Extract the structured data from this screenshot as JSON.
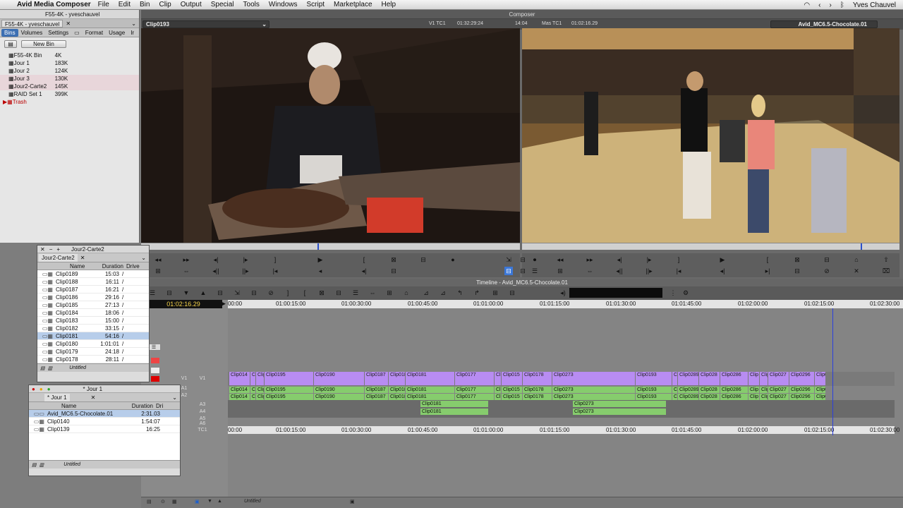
{
  "menubar": {
    "app": "Avid Media Composer",
    "items": [
      "File",
      "Edit",
      "Bin",
      "Clip",
      "Output",
      "Special",
      "Tools",
      "Windows",
      "Script",
      "Marketplace",
      "Help"
    ],
    "user": "Yves Chauvel"
  },
  "project": {
    "title": "F55-4K - yveschauvel",
    "tab": "F55-4K - yveschauvel",
    "tabs": [
      "Bins",
      "Volumes",
      "Settings",
      "Format",
      "Usage",
      "Ir"
    ],
    "new_bin": "New Bin",
    "bins": [
      {
        "name": "F55-4K Bin",
        "size": "4K"
      },
      {
        "name": "Jour 1",
        "size": "183K"
      },
      {
        "name": "Jour 2",
        "size": "124K"
      },
      {
        "name": "Jour 3",
        "size": "130K"
      },
      {
        "name": "Jour2-Carte2",
        "size": "145K"
      },
      {
        "name": "RAID Set 1",
        "size": "399K"
      },
      {
        "name": "Trash",
        "size": ""
      }
    ]
  },
  "composer": {
    "title": "Composer",
    "source_clip": "Clip0193",
    "v1_tc_label": "V1 TC1",
    "v1_tc": "01:32:29:24",
    "dur": "14:04",
    "mas_label": "Mas TC1",
    "mas_tc": "01:02:16.29",
    "record_seq": "Avid_MC6.5-Chocolate.01"
  },
  "timeline": {
    "title": "Timeline - Avid_MC6.5-Chocolate.01",
    "tc": "01:02:16.29",
    "ruler": [
      "00:00",
      "01:00:15:00",
      "01:00:30:00",
      "01:00:45:00",
      "01:01:00:00",
      "01:01:15:00",
      "01:01:30:00",
      "01:01:45:00",
      "01:02:00:00",
      "01:02:15:00",
      "01:02:30:00"
    ],
    "tracks": [
      "V1",
      "A1",
      "A2",
      "A3",
      "A4",
      "A5",
      "A6",
      "TC1"
    ],
    "v1_clips": [
      "Clip014",
      "Cl",
      "Clip",
      "Clip0195",
      "Clip0190",
      "Clip0187",
      "Clip0182",
      "Clip0181",
      "Clip0177",
      "Cl",
      "Clip015",
      "Clip0178",
      "Clip0273",
      "Clip0193",
      "Clip0",
      "Clip0289",
      "Clip028",
      "Clip0286",
      "Clip",
      "Clip",
      "Clip027",
      "Clip0296",
      "Clip0"
    ],
    "a3_clips": [
      "Clip0181",
      "Clip0273"
    ],
    "untitled": "Untitled"
  },
  "bin_carte2": {
    "title": "Jour2-Carte2",
    "tab": "Jour2-Carte2",
    "col_name": "Name",
    "col_dur": "Duration",
    "col_drive": "Drive",
    "rows": [
      {
        "n": "Clip0189",
        "d": "15:03"
      },
      {
        "n": "Clip0188",
        "d": "16:11"
      },
      {
        "n": "Clip0187",
        "d": "16:21"
      },
      {
        "n": "Clip0186",
        "d": "29:16"
      },
      {
        "n": "Clip0185",
        "d": "27:13"
      },
      {
        "n": "Clip0184",
        "d": "18:06"
      },
      {
        "n": "Clip0183",
        "d": "15:00"
      },
      {
        "n": "Clip0182",
        "d": "33:15"
      },
      {
        "n": "Clip0181",
        "d": "54:16"
      },
      {
        "n": "Clip0180",
        "d": "1:01:01"
      },
      {
        "n": "Clip0179",
        "d": "24:18"
      },
      {
        "n": "Clip0178",
        "d": "28:11"
      }
    ],
    "footer": "Untitled"
  },
  "bin_jour1": {
    "title": "* Jour 1",
    "tab": "* Jour 1",
    "col_name": "Name",
    "col_dur": "Duration",
    "col_drive": "Dri",
    "rows": [
      {
        "n": "Avid_MC6.5-Chocolate.01",
        "d": "2:31.03"
      },
      {
        "n": "Clip0140",
        "d": "1:54:07"
      },
      {
        "n": "Clip0139",
        "d": "16:25"
      }
    ],
    "footer": "Untitled"
  }
}
